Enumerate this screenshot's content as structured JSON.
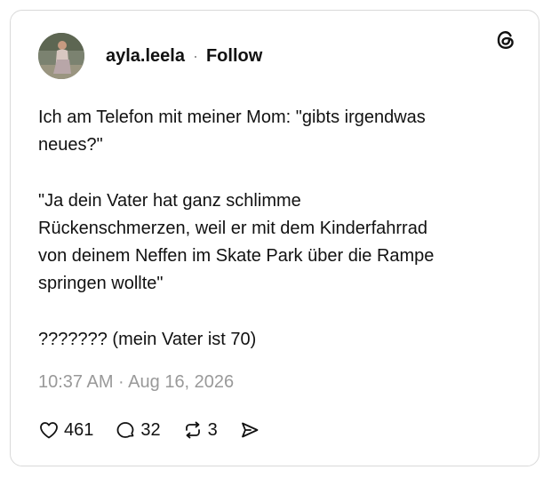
{
  "post": {
    "username": "ayla.leela",
    "separator": "·",
    "follow_label": "Follow",
    "lines": [
      "Ich am Telefon mit meiner Mom: \"gibts irgendwas",
      "neues?\"",
      "\"Ja dein Vater hat ganz schlimme",
      "Rückenschmerzen, weil er mit dem Kinderfahrrad",
      "von deinem Neffen im Skate Park über die Rampe",
      "springen wollte\"",
      "??????? (mein Vater ist 70)"
    ],
    "timestamp": "10:37 AM · Aug 16, 2026",
    "likes": "461",
    "replies": "32",
    "reposts": "3"
  },
  "icons": {
    "logo": "threads-logo-icon",
    "like": "heart-icon",
    "reply": "speech-bubble-icon",
    "repost": "repost-icon",
    "share": "send-icon"
  }
}
